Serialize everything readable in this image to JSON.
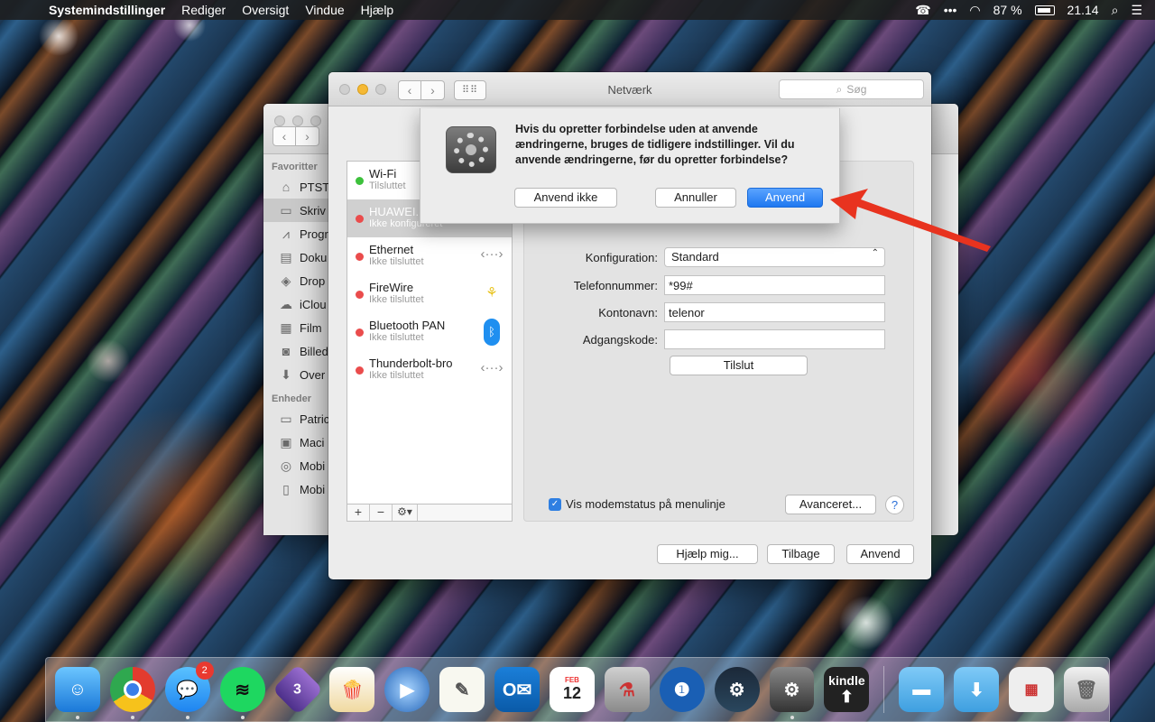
{
  "menubar": {
    "app": "Systemindstillinger",
    "items": [
      "Rediger",
      "Oversigt",
      "Vindue",
      "Hjælp"
    ],
    "battery": "87 %",
    "time": "21.14"
  },
  "back_window": {
    "favorites_header": "Favoritter",
    "favorites": [
      "PTST",
      "Skriv",
      "Progr",
      "Doku",
      "Drop",
      "iClou",
      "Film",
      "Billed",
      "Over"
    ],
    "devices_header": "Enheder",
    "devices": [
      "Patric",
      "Maci",
      "Mobi",
      "Mobi"
    ]
  },
  "window": {
    "title": "Netværk",
    "search_placeholder": "Søg"
  },
  "services": [
    {
      "name": "Wi-Fi",
      "status": "Tilsluttet",
      "dot": "#3dc13c",
      "icon": "wifi-icon"
    },
    {
      "name": "HUAWEI...",
      "status": "Ikke konfigureret",
      "dot": "#ea4c4c",
      "icon": "phone-icon"
    },
    {
      "name": "Ethernet",
      "status": "Ikke tilsluttet",
      "dot": "#ea4c4c",
      "icon": "ethernet-icon"
    },
    {
      "name": "FireWire",
      "status": "Ikke tilsluttet",
      "dot": "#ea4c4c",
      "icon": "firewire-icon"
    },
    {
      "name": "Bluetooth PAN",
      "status": "Ikke tilsluttet",
      "dot": "#ea4c4c",
      "icon": "bluetooth-icon"
    },
    {
      "name": "Thunderbolt-bro",
      "status": "Ikke tilsluttet",
      "dot": "#ea4c4c",
      "icon": "thunderbolt-icon"
    }
  ],
  "list_bar": {
    "add": "+",
    "remove": "−",
    "gear": "⚙▾"
  },
  "form": {
    "config_label": "Konfiguration:",
    "config_value": "Standard",
    "phone_label": "Telefonnummer:",
    "phone_value": "*99#",
    "account_label": "Kontonavn:",
    "account_value": "telenor",
    "password_label": "Adgangskode:",
    "password_value": "",
    "connect_button": "Tilslut",
    "modem_status_checkbox": "Vis modemstatus på menulinje",
    "advanced_button": "Avanceret...",
    "help": "?"
  },
  "bottom_buttons": {
    "assist": "Hjælp mig...",
    "back": "Tilbage",
    "apply": "Anvend"
  },
  "sheet": {
    "message": "Hvis du opretter forbindelse uden at anvende ændringerne, bruges de tidligere indstillinger. Vil du anvende ændringerne, før du opretter forbindelse?",
    "dont_apply": "Anvend ikke",
    "cancel": "Annuller",
    "apply": "Anvend"
  },
  "dock": {
    "messages_badge": "2",
    "calendar_month": "FEB",
    "calendar_day": "12",
    "kindle_label": "kindle",
    "three_label": "3"
  },
  "colors": {
    "accent": "#1f78f0",
    "arrow": "#e8331f"
  }
}
